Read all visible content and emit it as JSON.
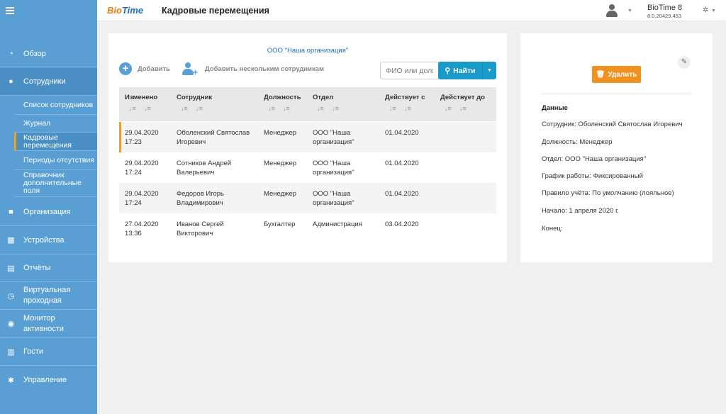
{
  "sidebar": {
    "items": [
      {
        "label": "Обзор",
        "icon": "gauge-icon"
      },
      {
        "label": "Сотрудники",
        "icon": "user-icon"
      },
      {
        "label": "Организация",
        "icon": "briefcase-icon"
      },
      {
        "label": "Устройства",
        "icon": "calendar-icon"
      },
      {
        "label": "Отчёты",
        "icon": "document-icon"
      },
      {
        "label": "Виртуальная проходная",
        "icon": "clock-icon"
      },
      {
        "label": "Монитор активности",
        "icon": "user-circle-icon"
      },
      {
        "label": "Гости",
        "icon": "building-icon"
      },
      {
        "label": "Управление",
        "icon": "gear-icon"
      }
    ],
    "subitems": [
      {
        "label": "Список сотрудников"
      },
      {
        "label": "Журнал"
      },
      {
        "label": "Кадровые перемещения"
      },
      {
        "label": "Периоды отсутствия"
      },
      {
        "label": "Справочник дополнительные поля"
      }
    ]
  },
  "header": {
    "logo_part1": "Bio",
    "logo_part2": "Time",
    "title": "Кадровые перемещения",
    "app_name": "BioTime 8",
    "app_version": "8.0.20429.453"
  },
  "main": {
    "org_link": "ООО \"Наша организация\"",
    "add_label": "Добавить",
    "add_multi_label": "Добавить нескольким сотрудникам",
    "search_placeholder": "ФИО или должность",
    "search_button": "Найти",
    "columns": [
      "Изменено",
      "Сотрудник",
      "Должность",
      "Отдел",
      "Действует с",
      "Действует до"
    ],
    "rows": [
      {
        "changed_date": "29.04.2020",
        "changed_time": "17:23",
        "employee_line1": "Оболенский Святослав",
        "employee_line2": "Игоревич",
        "position": "Менеджер",
        "dept_line1": "ООО \"Наша",
        "dept_line2": "организация\"",
        "from": "01.04.2020",
        "to": ""
      },
      {
        "changed_date": "29.04.2020",
        "changed_time": "17:24",
        "employee_line1": "Сотников Андрей",
        "employee_line2": "Валерьевич",
        "position": "Менеджер",
        "dept_line1": "ООО \"Наша",
        "dept_line2": "организация\"",
        "from": "01.04.2020",
        "to": ""
      },
      {
        "changed_date": "29.04.2020",
        "changed_time": "17:24",
        "employee_line1": "Федоров Игорь",
        "employee_line2": "Владимирович",
        "position": "Менеджер",
        "dept_line1": "ООО \"Наша",
        "dept_line2": "организация\"",
        "from": "01.04.2020",
        "to": ""
      },
      {
        "changed_date": "27.04.2020",
        "changed_time": "13:36",
        "employee_line1": "Иванов Сергей",
        "employee_line2": "Викторович",
        "position": "Бухгалтер",
        "dept_line1": "Администрация",
        "dept_line2": "",
        "from": "03.04.2020",
        "to": ""
      }
    ]
  },
  "details": {
    "delete_label": "Удалить",
    "section_title": "Данные",
    "employee": "Сотрудник: Оболенский Святослав Игоревич",
    "position": "Должность: Менеджер",
    "department": "Отдел: ООО \"Наша организация\"",
    "schedule": "График работы: Фиксированный",
    "rule": "Правило учёта: По умолчанию (лояльное)",
    "start": "Начало: 1 апреля 2020 г.",
    "end": "Конец:"
  },
  "colors": {
    "sidebar": "#5a9fd4",
    "accent_orange": "#f0901e",
    "search_button": "#1a9ac9",
    "link": "#1b6fbf"
  }
}
